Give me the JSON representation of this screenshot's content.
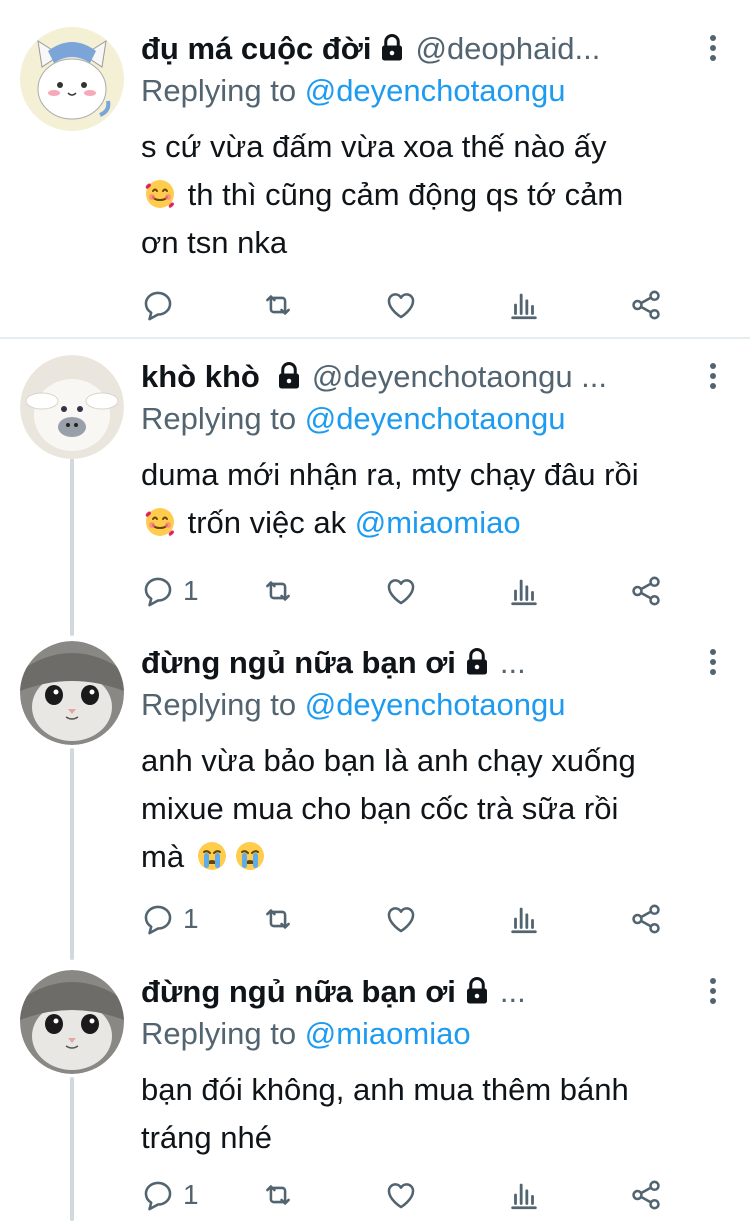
{
  "colors": {
    "accent": "#1d9bf0",
    "muted": "#536471",
    "text": "#0f1419",
    "divider": "#e6ecf0",
    "thread": "#cfd9de"
  },
  "replies": [
    {
      "name": "đụ má cuộc đời",
      "handle": "@deophaid...",
      "replying_label": "Replying to",
      "replying_to": "@deyenchotaongu",
      "text_line1": "s cứ vừa đấm vừa xoa thế nào ấy",
      "text_line2": "th thì cũng cảm động qs tớ cảm",
      "text_line3": "ơn tsn nka",
      "reply_count": "",
      "avatar_icon": "cartoon-cat-avatar"
    },
    {
      "name": "khò khò",
      "handle": "@deyenchotaongu ...",
      "replying_label": "Replying to",
      "replying_to": "@deyenchotaongu",
      "text_line1": "duma mới nhận ra, mty chạy đâu rồi",
      "text_line2": "trốn việc ak",
      "text_mention": "@miaomiao",
      "reply_count": "1",
      "avatar_icon": "plush-toy-avatar"
    },
    {
      "name": "đừng ngủ nữa bạn ơi",
      "handle": "...",
      "replying_label": "Replying to",
      "replying_to": "@deyenchotaongu",
      "text_line1": "anh vừa bảo bạn là anh chạy xuống",
      "text_line2": "mixue mua cho bạn cốc trà sữa rồi",
      "text_line3": "mà",
      "reply_count": "1",
      "avatar_icon": "cat-photo-avatar"
    },
    {
      "name": "đừng ngủ nữa bạn ơi",
      "handle": "...",
      "replying_label": "Replying to",
      "replying_to": "@miaomiao",
      "text_line1": "bạn đói không, anh mua thêm bánh",
      "text_line2": "tráng nhé",
      "reply_count": "1",
      "avatar_icon": "cat-photo-avatar"
    }
  ]
}
